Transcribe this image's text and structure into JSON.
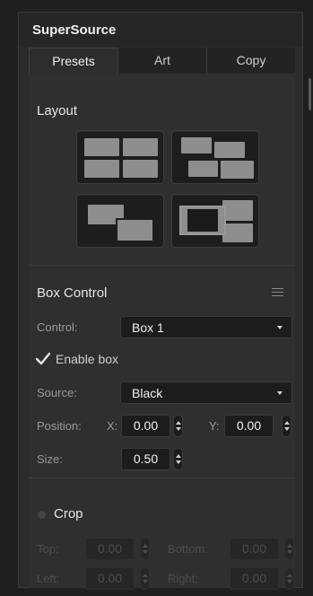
{
  "panel": {
    "title": "SuperSource"
  },
  "tabs": [
    {
      "label": "Presets",
      "active": true
    },
    {
      "label": "Art",
      "active": false
    },
    {
      "label": "Copy",
      "active": false
    }
  ],
  "layout": {
    "title": "Layout",
    "presets": [
      {
        "name": "four-box-grid"
      },
      {
        "name": "staggered-boxes"
      },
      {
        "name": "two-box-overlap"
      },
      {
        "name": "art-with-boxes"
      }
    ]
  },
  "box_control": {
    "title": "Box Control",
    "control_label": "Control:",
    "control_value": "Box 1",
    "enable_label": "Enable box",
    "enable_checked": true,
    "source_label": "Source:",
    "source_value": "Black",
    "position_label": "Position:",
    "x_label": "X:",
    "x_value": "0.00",
    "y_label": "Y:",
    "y_value": "0.00",
    "size_label": "Size:",
    "size_value": "0.50"
  },
  "crop": {
    "title": "Crop",
    "enabled": false,
    "top_label": "Top:",
    "top_value": "0.00",
    "bottom_label": "Bottom:",
    "bottom_value": "0.00",
    "left_label": "Left:",
    "left_value": "0.00",
    "right_label": "Right:",
    "right_value": "0.00"
  },
  "colors": {
    "panel_bg": "#2b2b2b",
    "field_bg": "#1c1c1c",
    "box_fill": "#8e8e8e",
    "dim_text": "#4d4d4d"
  }
}
